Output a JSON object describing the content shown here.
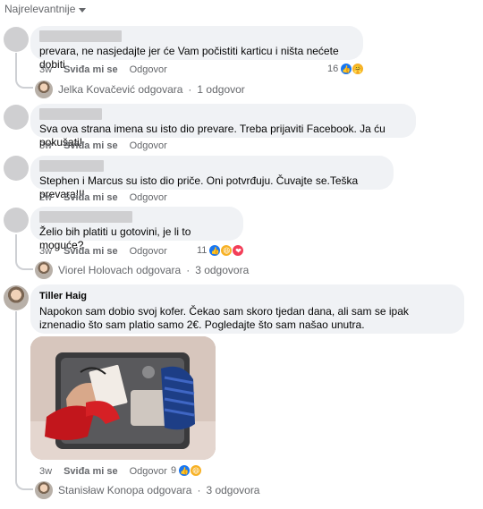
{
  "sort": {
    "label": "Najrelevantnije"
  },
  "comments": [
    {
      "text": "prevara, ne nasjedajte jer će Vam počistiti karticu i ništa nećete dobiti",
      "time": "3w",
      "like": "Sviđa mi se",
      "reply": "Odgovor",
      "reaction_count": "16",
      "replies": {
        "name": "Jelka Kovačević odgovara",
        "sep": "·",
        "count": "1 odgovor"
      }
    },
    {
      "text": "Sva ova strana imena su isto dio prevare. Treba prijaviti Facebook. Ja ću pokušati!",
      "time": "3w",
      "like": "Sviđa mi se",
      "reply": "Odgovor"
    },
    {
      "text": "Stephen i Marcus su isto dio priče. Oni potvrđuju. Čuvajte se.Teška prevara!!!",
      "time": "2w",
      "like": "Sviđa mi se",
      "reply": "Odgovor"
    },
    {
      "text": "Želio bih platiti u gotovini, je li to moguće?",
      "time": "3w",
      "like": "Sviđa mi se",
      "reply": "Odgovor",
      "reaction_count": "11",
      "replies": {
        "name": "Viorel Holovach odgovara",
        "sep": "·",
        "count": "3 odgovora"
      }
    },
    {
      "author": "Tiller Haig",
      "text": "Napokon sam dobio svoj kofer. Čekao sam skoro tjedan dana, ali sam se ipak iznenadio što sam platio samo 2€. Pogledajte što sam našao unutra.",
      "time": "3w",
      "like": "Sviđa mi se",
      "reply": "Odgovor",
      "reaction_count": "9",
      "replies": {
        "name": "Stanisław Konopa odgovara",
        "sep": "·",
        "count": "3 odgovora"
      }
    }
  ],
  "colors": {
    "bubble": "#f0f2f5",
    "meta": "#65676b",
    "like_blue": "#1877f2",
    "love_red": "#f33e58",
    "haha_yellow": "#f7b125"
  },
  "icons": {
    "sort": "chevron-down-icon",
    "like": "like-reaction-icon",
    "haha": "haha-reaction-icon",
    "care": "care-reaction-icon",
    "love": "love-reaction-icon"
  }
}
